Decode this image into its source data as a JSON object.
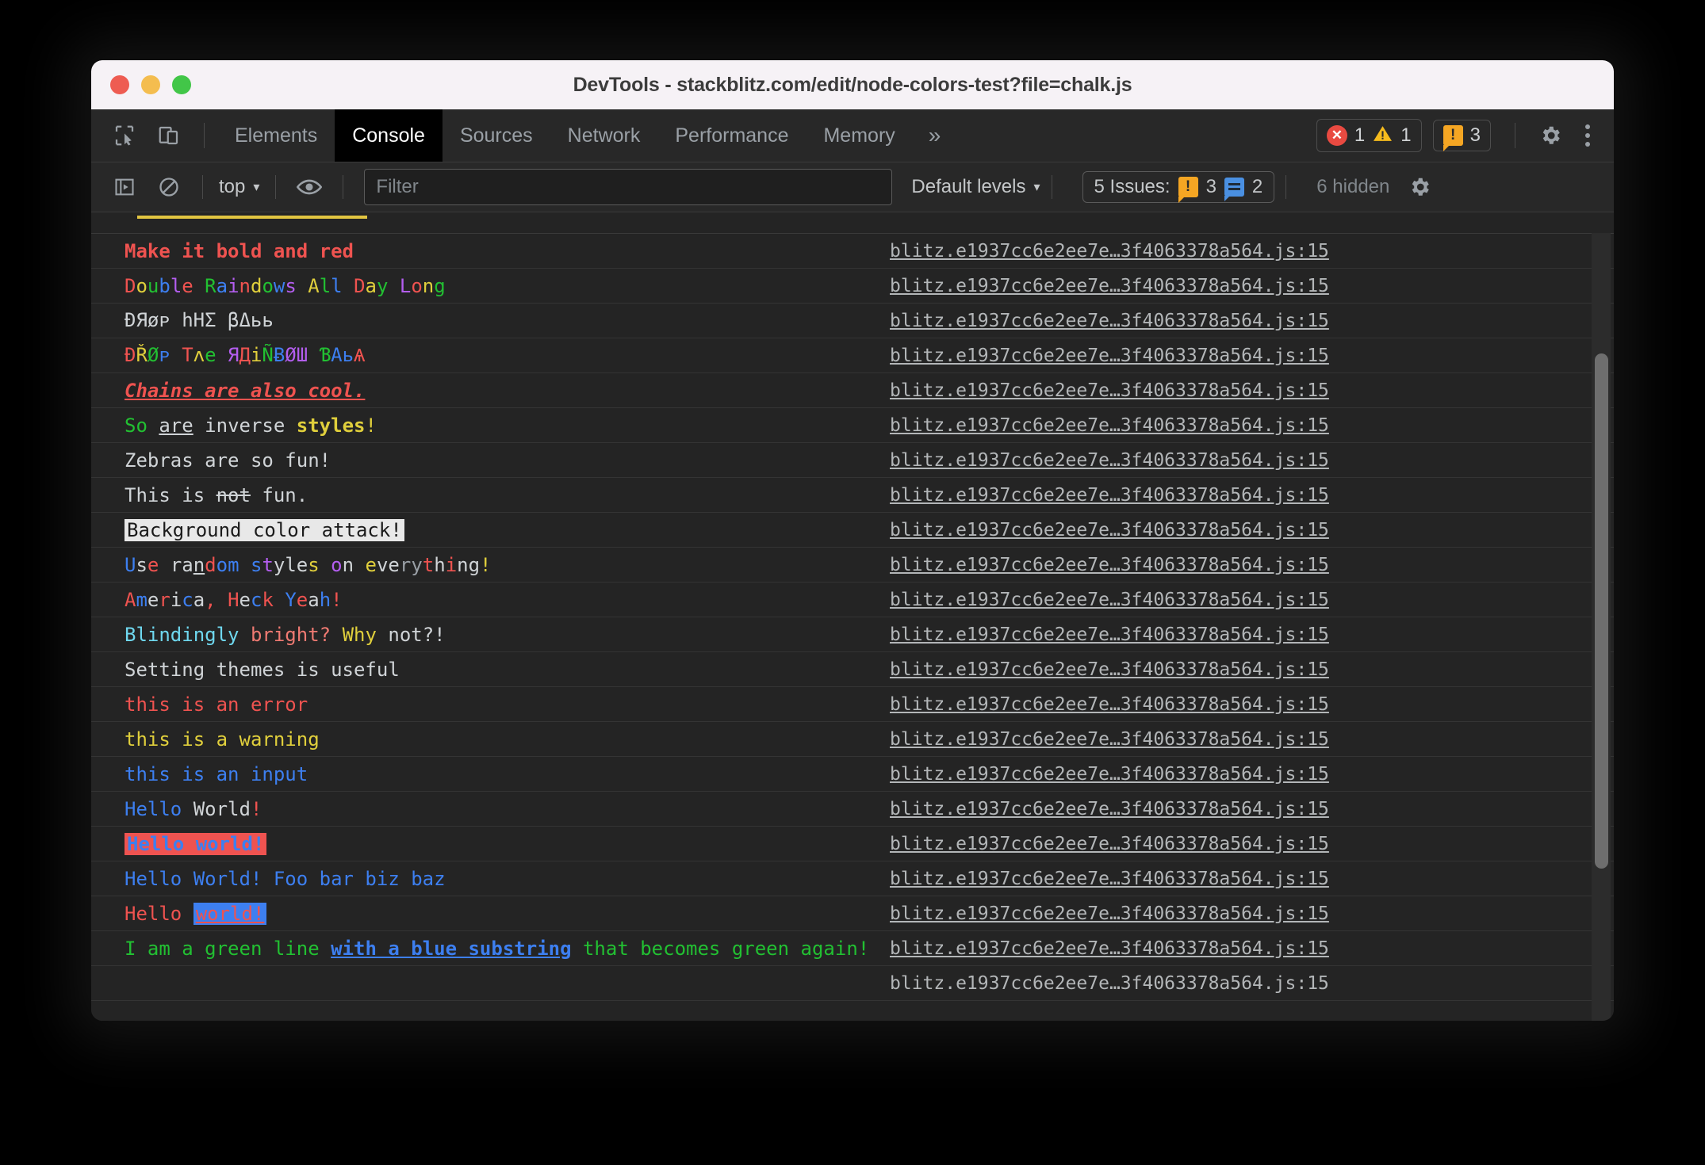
{
  "window": {
    "title": "DevTools - stackblitz.com/edit/node-colors-test?file=chalk.js",
    "traffic": {
      "close": "close-button",
      "minimize": "minimize-button",
      "zoom": "zoom-button"
    }
  },
  "tabbar": {
    "inspect_icon": "inspect-element-icon",
    "device_icon": "device-toolbar-icon",
    "tabs": [
      {
        "label": "Elements",
        "active": false
      },
      {
        "label": "Console",
        "active": true
      },
      {
        "label": "Sources",
        "active": false
      },
      {
        "label": "Network",
        "active": false
      },
      {
        "label": "Performance",
        "active": false
      },
      {
        "label": "Memory",
        "active": false
      }
    ],
    "more_label": "»",
    "error_count": "1",
    "warning_count": "1",
    "issue_count": "3",
    "settings_icon": "gear-icon",
    "menu_icon": "kebab-menu-icon"
  },
  "console_toolbar": {
    "sidebar_icon": "show-console-sidebar-icon",
    "clear_icon": "clear-console-icon",
    "context": "top",
    "context_caret": "▾",
    "eye_icon": "live-expression-icon",
    "filter_placeholder": "Filter",
    "filter_value": "",
    "levels": "Default levels",
    "levels_caret": "▾",
    "issues_label": "5 Issues:",
    "issues_warning_count": "3",
    "issues_info_count": "2",
    "hidden_label": "6 hidden",
    "settings_icon": "console-settings-gear-icon"
  },
  "colors": {
    "red": "#e5534b",
    "bright_red": "#ef5350",
    "green": "#22c032",
    "blue": "#3d7ff0",
    "yellow": "#e0cf3c",
    "magenta": "#b45ef0",
    "cyan": "#57d6e8",
    "white": "#d0d4d7",
    "gray": "#9aa0a6",
    "salmon": "#ef7a72",
    "light_cyan": "#6fd8ef"
  },
  "source_link": "blitz.e1937cc6e2ee7e…3f4063378a564.js:15",
  "messages": [
    {
      "text": "Make it bold and red"
    },
    {
      "text": "Double Raindows All Day Long"
    },
    {
      "text": "ÐЯøᴘ һΗΣ βΔьь"
    },
    {
      "text": "ÐŘØᴘ Tʌe ЯДiÑɃØШ ƁΑьѦ"
    },
    {
      "text": "Chains are also cool."
    },
    {
      "text": "So are inverse styles!"
    },
    {
      "text": "Zebras are so fun!"
    },
    {
      "text": "This is not fun."
    },
    {
      "text": "Background color attack!"
    },
    {
      "text": "Use random styles on everything!"
    },
    {
      "text": "America, Heck Yeah!"
    },
    {
      "text": "Blindingly bright? Why not?!"
    },
    {
      "text": "Setting themes is useful"
    },
    {
      "text": "this is an error"
    },
    {
      "text": "this is a warning"
    },
    {
      "text": "this is an input"
    },
    {
      "text": "Hello World!"
    },
    {
      "text": "Hello world!"
    },
    {
      "text": "Hello World! Foo bar biz baz"
    },
    {
      "text": "Hello world!"
    },
    {
      "text": "I am a green line with a blue substring that becomes green again!"
    },
    {
      "text": ""
    }
  ]
}
